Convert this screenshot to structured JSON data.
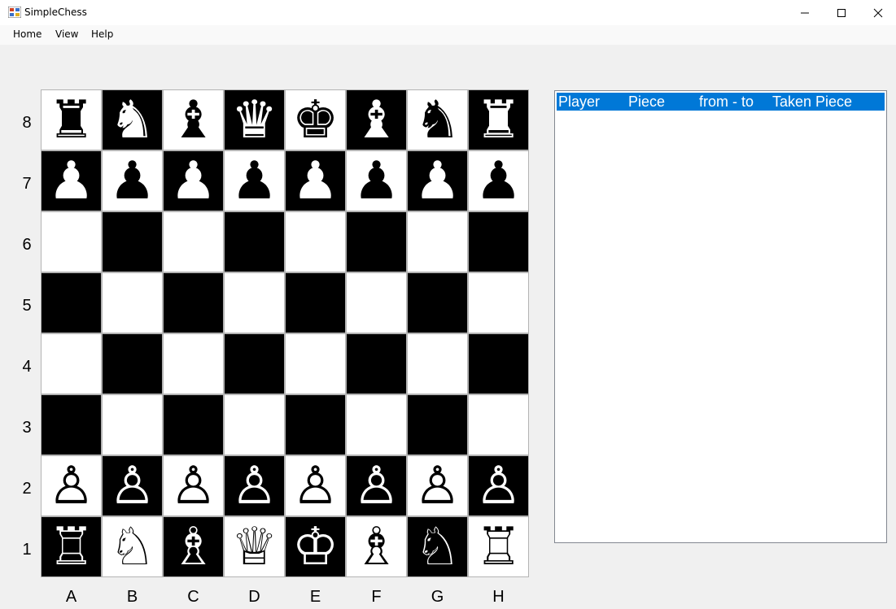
{
  "window": {
    "title": "SimpleChess",
    "controls": {
      "minimize": "─",
      "maximize": "☐",
      "close": "✕"
    }
  },
  "menu": [
    "Home",
    "View",
    "Help"
  ],
  "board": {
    "files": [
      "A",
      "B",
      "C",
      "D",
      "E",
      "F",
      "G",
      "H"
    ],
    "ranks": [
      "8",
      "7",
      "6",
      "5",
      "4",
      "3",
      "2",
      "1"
    ],
    "rows": [
      [
        "♜",
        "♞",
        "♝",
        "♛",
        "♚",
        "♝",
        "♞",
        "♜"
      ],
      [
        "♟",
        "♟",
        "♟",
        "♟",
        "♟",
        "♟",
        "♟",
        "♟"
      ],
      [
        "",
        "",
        "",
        "",
        "",
        "",
        "",
        ""
      ],
      [
        "",
        "",
        "",
        "",
        "",
        "",
        "",
        ""
      ],
      [
        "",
        "",
        "",
        "",
        "",
        "",
        "",
        ""
      ],
      [
        "",
        "",
        "",
        "",
        "",
        "",
        "",
        ""
      ],
      [
        "♙",
        "♙",
        "♙",
        "♙",
        "♙",
        "♙",
        "♙",
        "♙"
      ],
      [
        "♖",
        "♘",
        "♗",
        "♕",
        "♔",
        "♗",
        "♘",
        "♖"
      ]
    ],
    "pieceNames": [
      [
        "black-rook",
        "black-knight",
        "black-bishop",
        "black-queen",
        "black-king",
        "black-bishop",
        "black-knight",
        "black-rook"
      ],
      [
        "black-pawn",
        "black-pawn",
        "black-pawn",
        "black-pawn",
        "black-pawn",
        "black-pawn",
        "black-pawn",
        "black-pawn"
      ],
      [],
      [],
      [],
      [],
      [
        "white-pawn",
        "white-pawn",
        "white-pawn",
        "white-pawn",
        "white-pawn",
        "white-pawn",
        "white-pawn",
        "white-pawn"
      ],
      [
        "white-rook",
        "white-knight",
        "white-bishop",
        "white-queen",
        "white-king",
        "white-bishop",
        "white-knight",
        "white-rook"
      ]
    ],
    "colors": {
      "light": "#ffffff",
      "dark": "#000000"
    }
  },
  "moveList": {
    "columns": [
      "Player",
      "Piece",
      "from - to",
      "Taken Piece"
    ],
    "rows": [],
    "headerColor": "#0078d7"
  }
}
